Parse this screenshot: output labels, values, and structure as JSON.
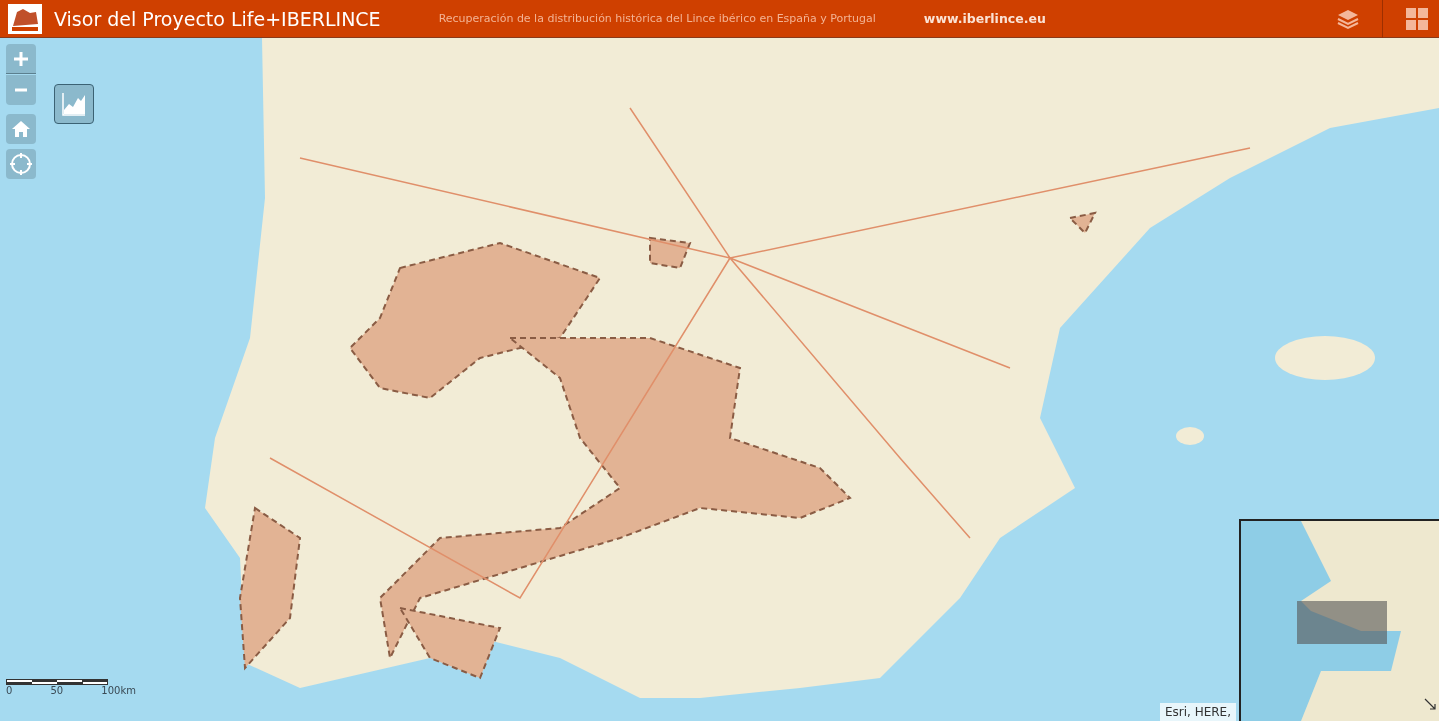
{
  "header": {
    "title": "Visor del Proyecto Life+IBERLINCE",
    "subtitle": "Recuperación de la distribución histórica del Lince ibérico en España y Portugal",
    "link": "www.iberlince.eu"
  },
  "scale_bar": {
    "labels": [
      "0",
      "50",
      "100km"
    ]
  },
  "attribution": "Esri, HERE,"
}
